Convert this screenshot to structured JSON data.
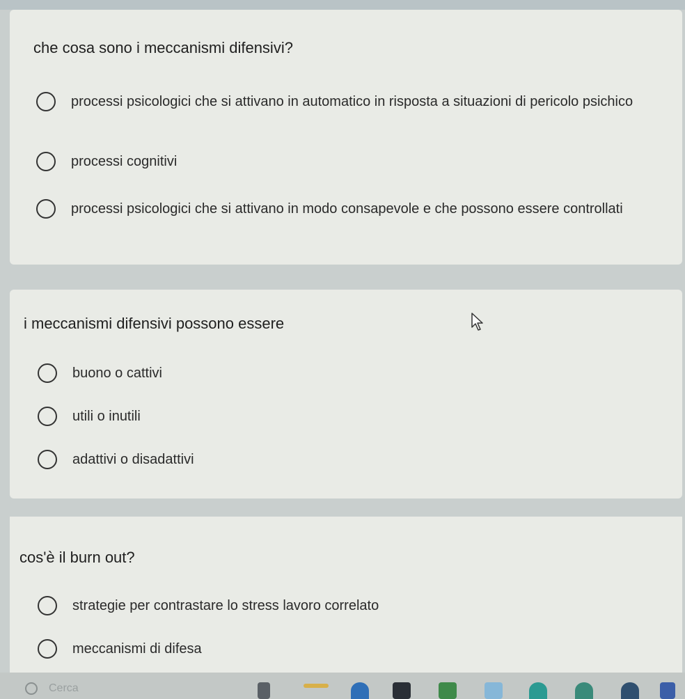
{
  "questions": [
    {
      "text": "che cosa sono i meccanismi difensivi?",
      "options": [
        "processi psicologici che si attivano in automatico in risposta a situazioni di pericolo psichico",
        "processi cognitivi",
        "processi psicologici che si attivano in modo consapevole e che possono essere controllati"
      ]
    },
    {
      "text": "i meccanismi difensivi possono essere",
      "options": [
        "buono o cattivi",
        "utili o inutili",
        "adattivi o disadattivi"
      ]
    },
    {
      "text": "cos'è il burn out?",
      "options": [
        "strategie per contrastare lo stress lavoro correlato",
        "meccanismi di difesa"
      ]
    }
  ],
  "taskbar": {
    "search_label": "Cerca"
  },
  "colors": {
    "card_bg": "#e9ebe6",
    "page_bg": "#c9cfce",
    "text": "#222222"
  }
}
